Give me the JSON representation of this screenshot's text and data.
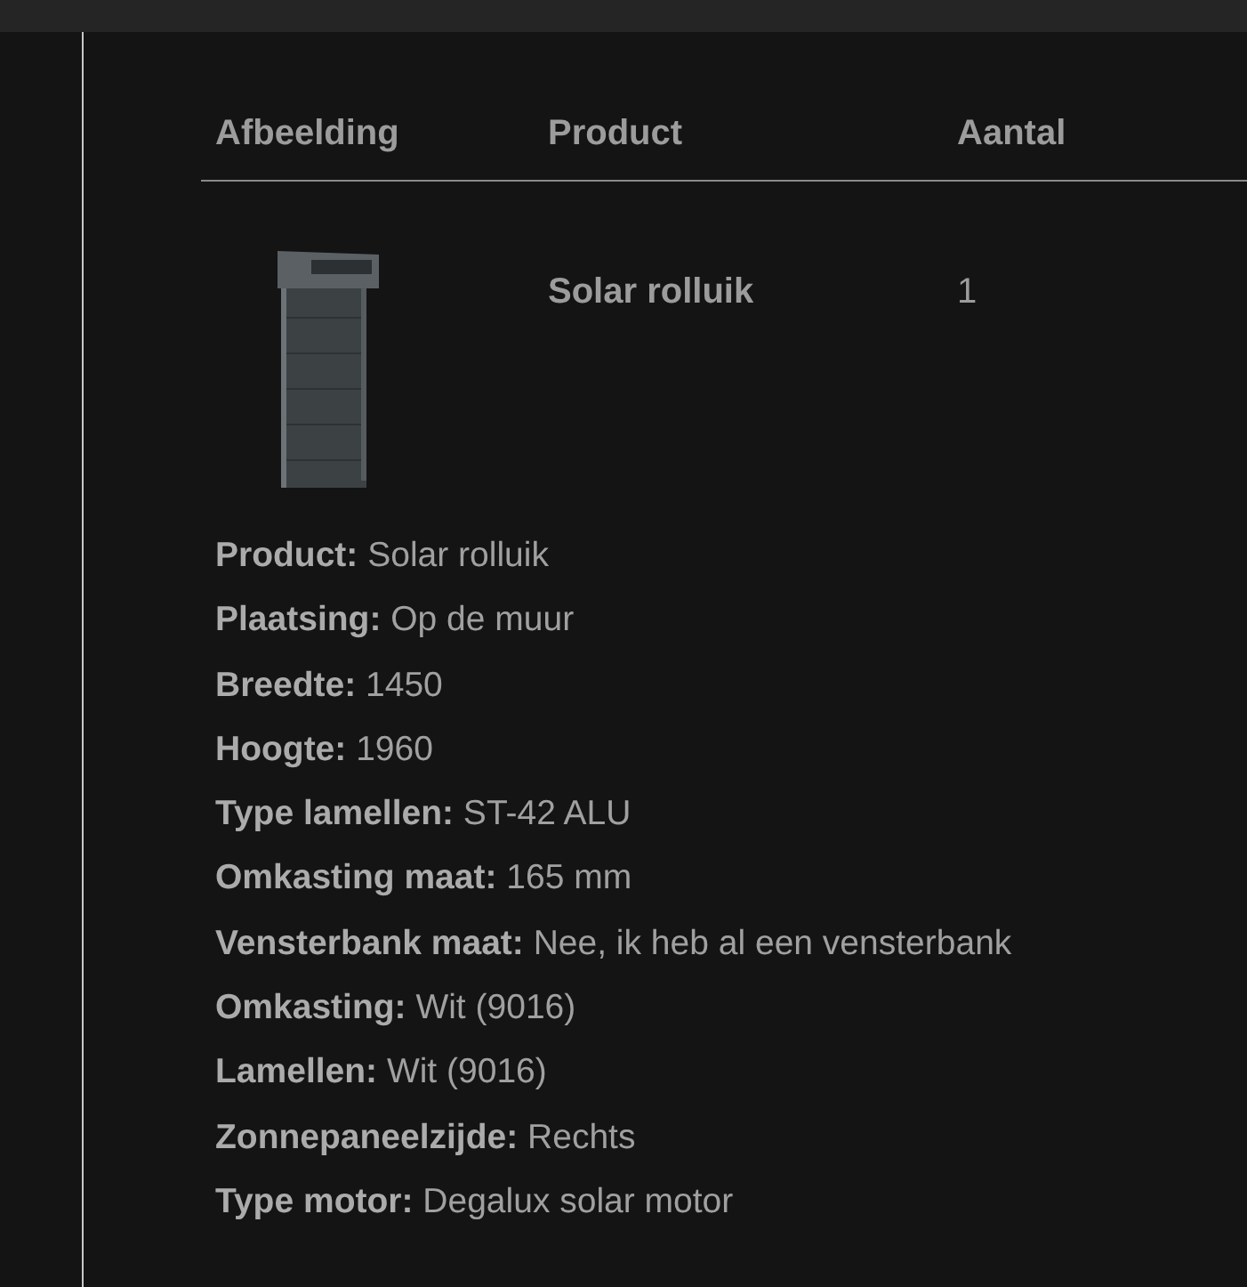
{
  "table": {
    "columns": [
      "Afbeelding",
      "Product",
      "Aantal"
    ],
    "rows": [
      {
        "product": "Solar rolluik",
        "quantity": "1"
      }
    ]
  },
  "details": [
    "**Product:** Solar rolluik",
    "**Plaatsing:** Op de muur",
    "**Breedte:** 1450",
    "**Hoogte:** 1960",
    "**Type lamellen:** ST-42 ALU",
    "**Omkasting maat:** 165 mm",
    "**Vensterbank maat:** Nee, ik heb al een vensterbank",
    "**Omkasting:** Wit (9016)",
    "**Lamellen:** Wit (9016)",
    "**Zonnepaneelzijde:** Rechts",
    "**Type motor:** Degalux solar motor"
  ]
}
